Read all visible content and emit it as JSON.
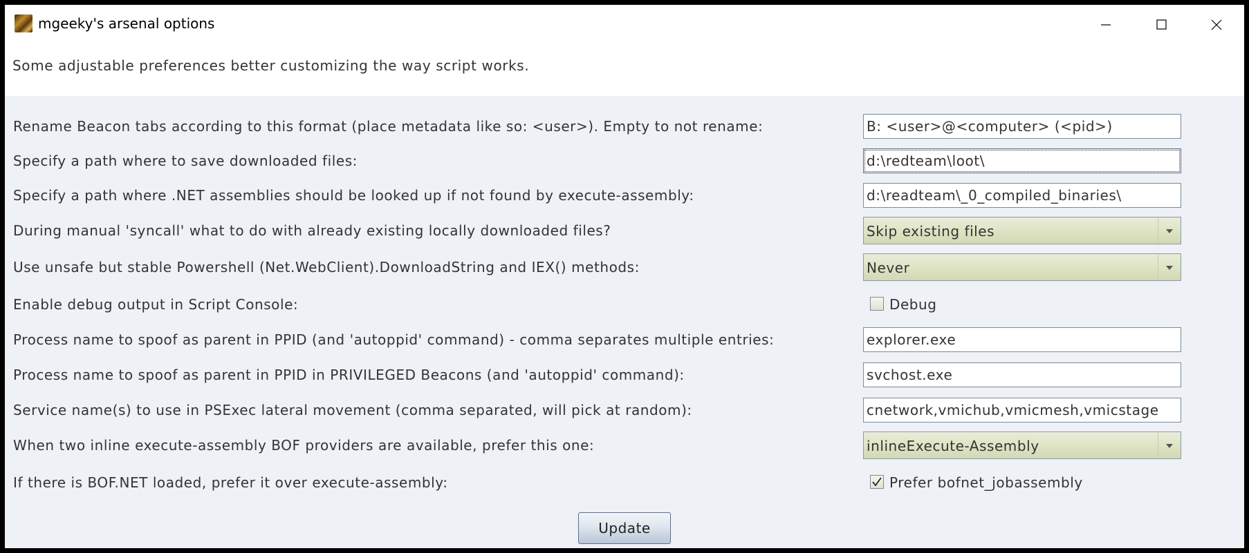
{
  "window": {
    "title": "mgeeky's arsenal options",
    "icon": "app-icon"
  },
  "header": {
    "description": "Some adjustable preferences better customizing the way script works."
  },
  "settings": [
    {
      "label": "Rename Beacon tabs according to this format (place metadata like so: <user>). Empty to not rename:",
      "type": "text",
      "value": "B: <user>@<computer> (<pid>)"
    },
    {
      "label": "Specify a path where to save downloaded files:",
      "type": "text",
      "value": "d:\\redteam\\loot\\"
    },
    {
      "label": "Specify a path where .NET assemblies should be looked up if not found by execute-assembly:",
      "type": "text",
      "value": "d:\\readteam\\_0_compiled_binaries\\"
    },
    {
      "label": "During manual 'syncall' what to do with already existing locally downloaded files?",
      "type": "select",
      "value": "Skip existing files"
    },
    {
      "label": "Use unsafe but stable Powershell (Net.WebClient).DownloadString and IEX() methods:",
      "type": "select",
      "value": "Never"
    },
    {
      "label": "Enable debug output in Script Console:",
      "type": "checkbox",
      "checkbox_label": "Debug",
      "checked": false
    },
    {
      "label": "Process name to spoof as parent in PPID (and 'autoppid' command) - comma separates multiple entries:",
      "type": "text",
      "value": "explorer.exe"
    },
    {
      "label": "Process name to spoof as parent in PPID in PRIVILEGED Beacons (and 'autoppid' command):",
      "type": "text",
      "value": "svchost.exe"
    },
    {
      "label": "Service name(s) to use in PSExec lateral movement (comma separated, will pick at random):",
      "type": "text",
      "value": "cnetwork,vmichub,vmicmesh,vmicstage"
    },
    {
      "label": "When two inline execute-assembly BOF providers are available, prefer this one:",
      "type": "select",
      "value": "inlineExecute-Assembly"
    },
    {
      "label": "If there is BOF.NET loaded, prefer it over execute-assembly:",
      "type": "checkbox",
      "checkbox_label": "Prefer bofnet_jobassembly",
      "checked": true
    }
  ],
  "actions": {
    "update_label": "Update"
  },
  "colors": {
    "panel_background": "#eef1f6",
    "combo_background": "#dfe4c5",
    "text": "#333333"
  }
}
